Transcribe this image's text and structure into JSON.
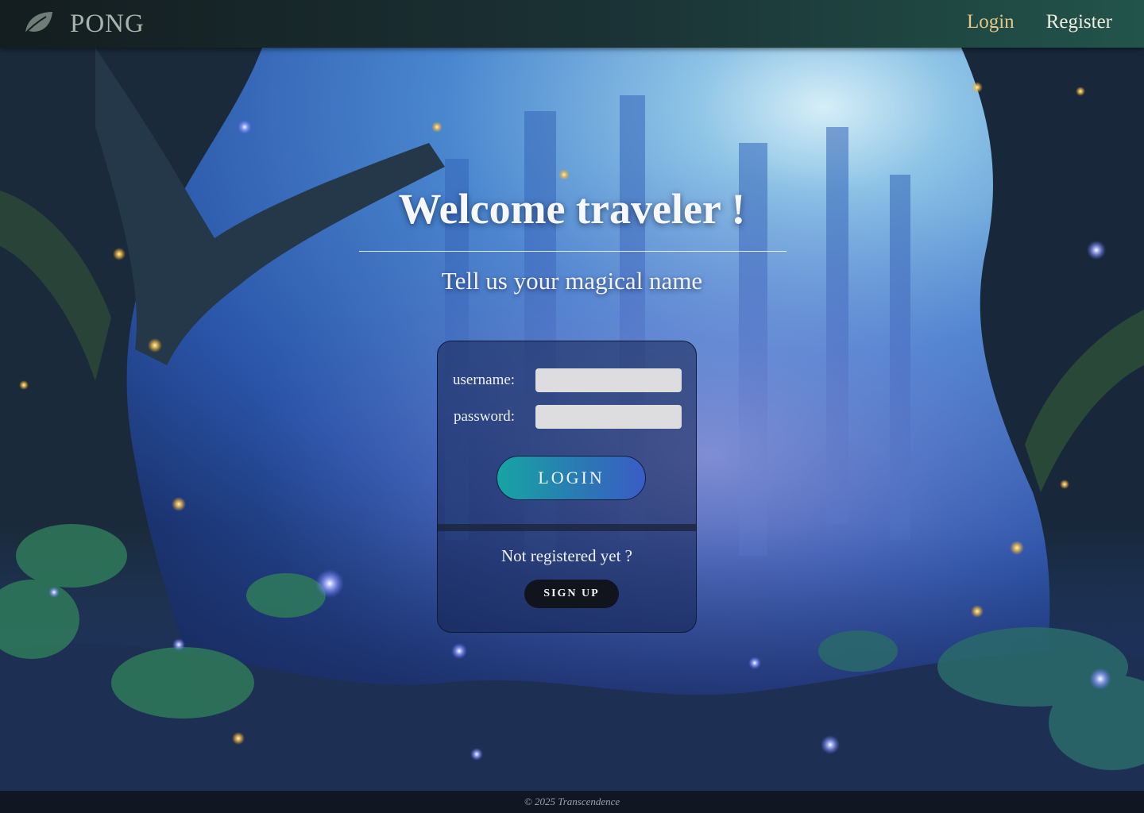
{
  "navbar": {
    "brand": "PONG",
    "brand_icon": "leaf-icon",
    "links": [
      {
        "label": "Login",
        "active": true
      },
      {
        "label": "Register",
        "active": false
      }
    ]
  },
  "hero": {
    "title": "Welcome traveler !",
    "subtitle": "Tell us your magical name"
  },
  "login_form": {
    "username_label": "username:",
    "username_value": "",
    "password_label": "password:",
    "password_value": "",
    "login_button": "LOGIN",
    "not_registered": "Not registered yet ?",
    "signup_button": "SIGN UP"
  },
  "footer": {
    "text": "© 2025 Transcendence"
  },
  "colors": {
    "active_link": "#e6c789",
    "login_gradient_start": "#17a4a4",
    "login_gradient_end": "#3a5cc6",
    "signup_bg": "#11141d"
  }
}
